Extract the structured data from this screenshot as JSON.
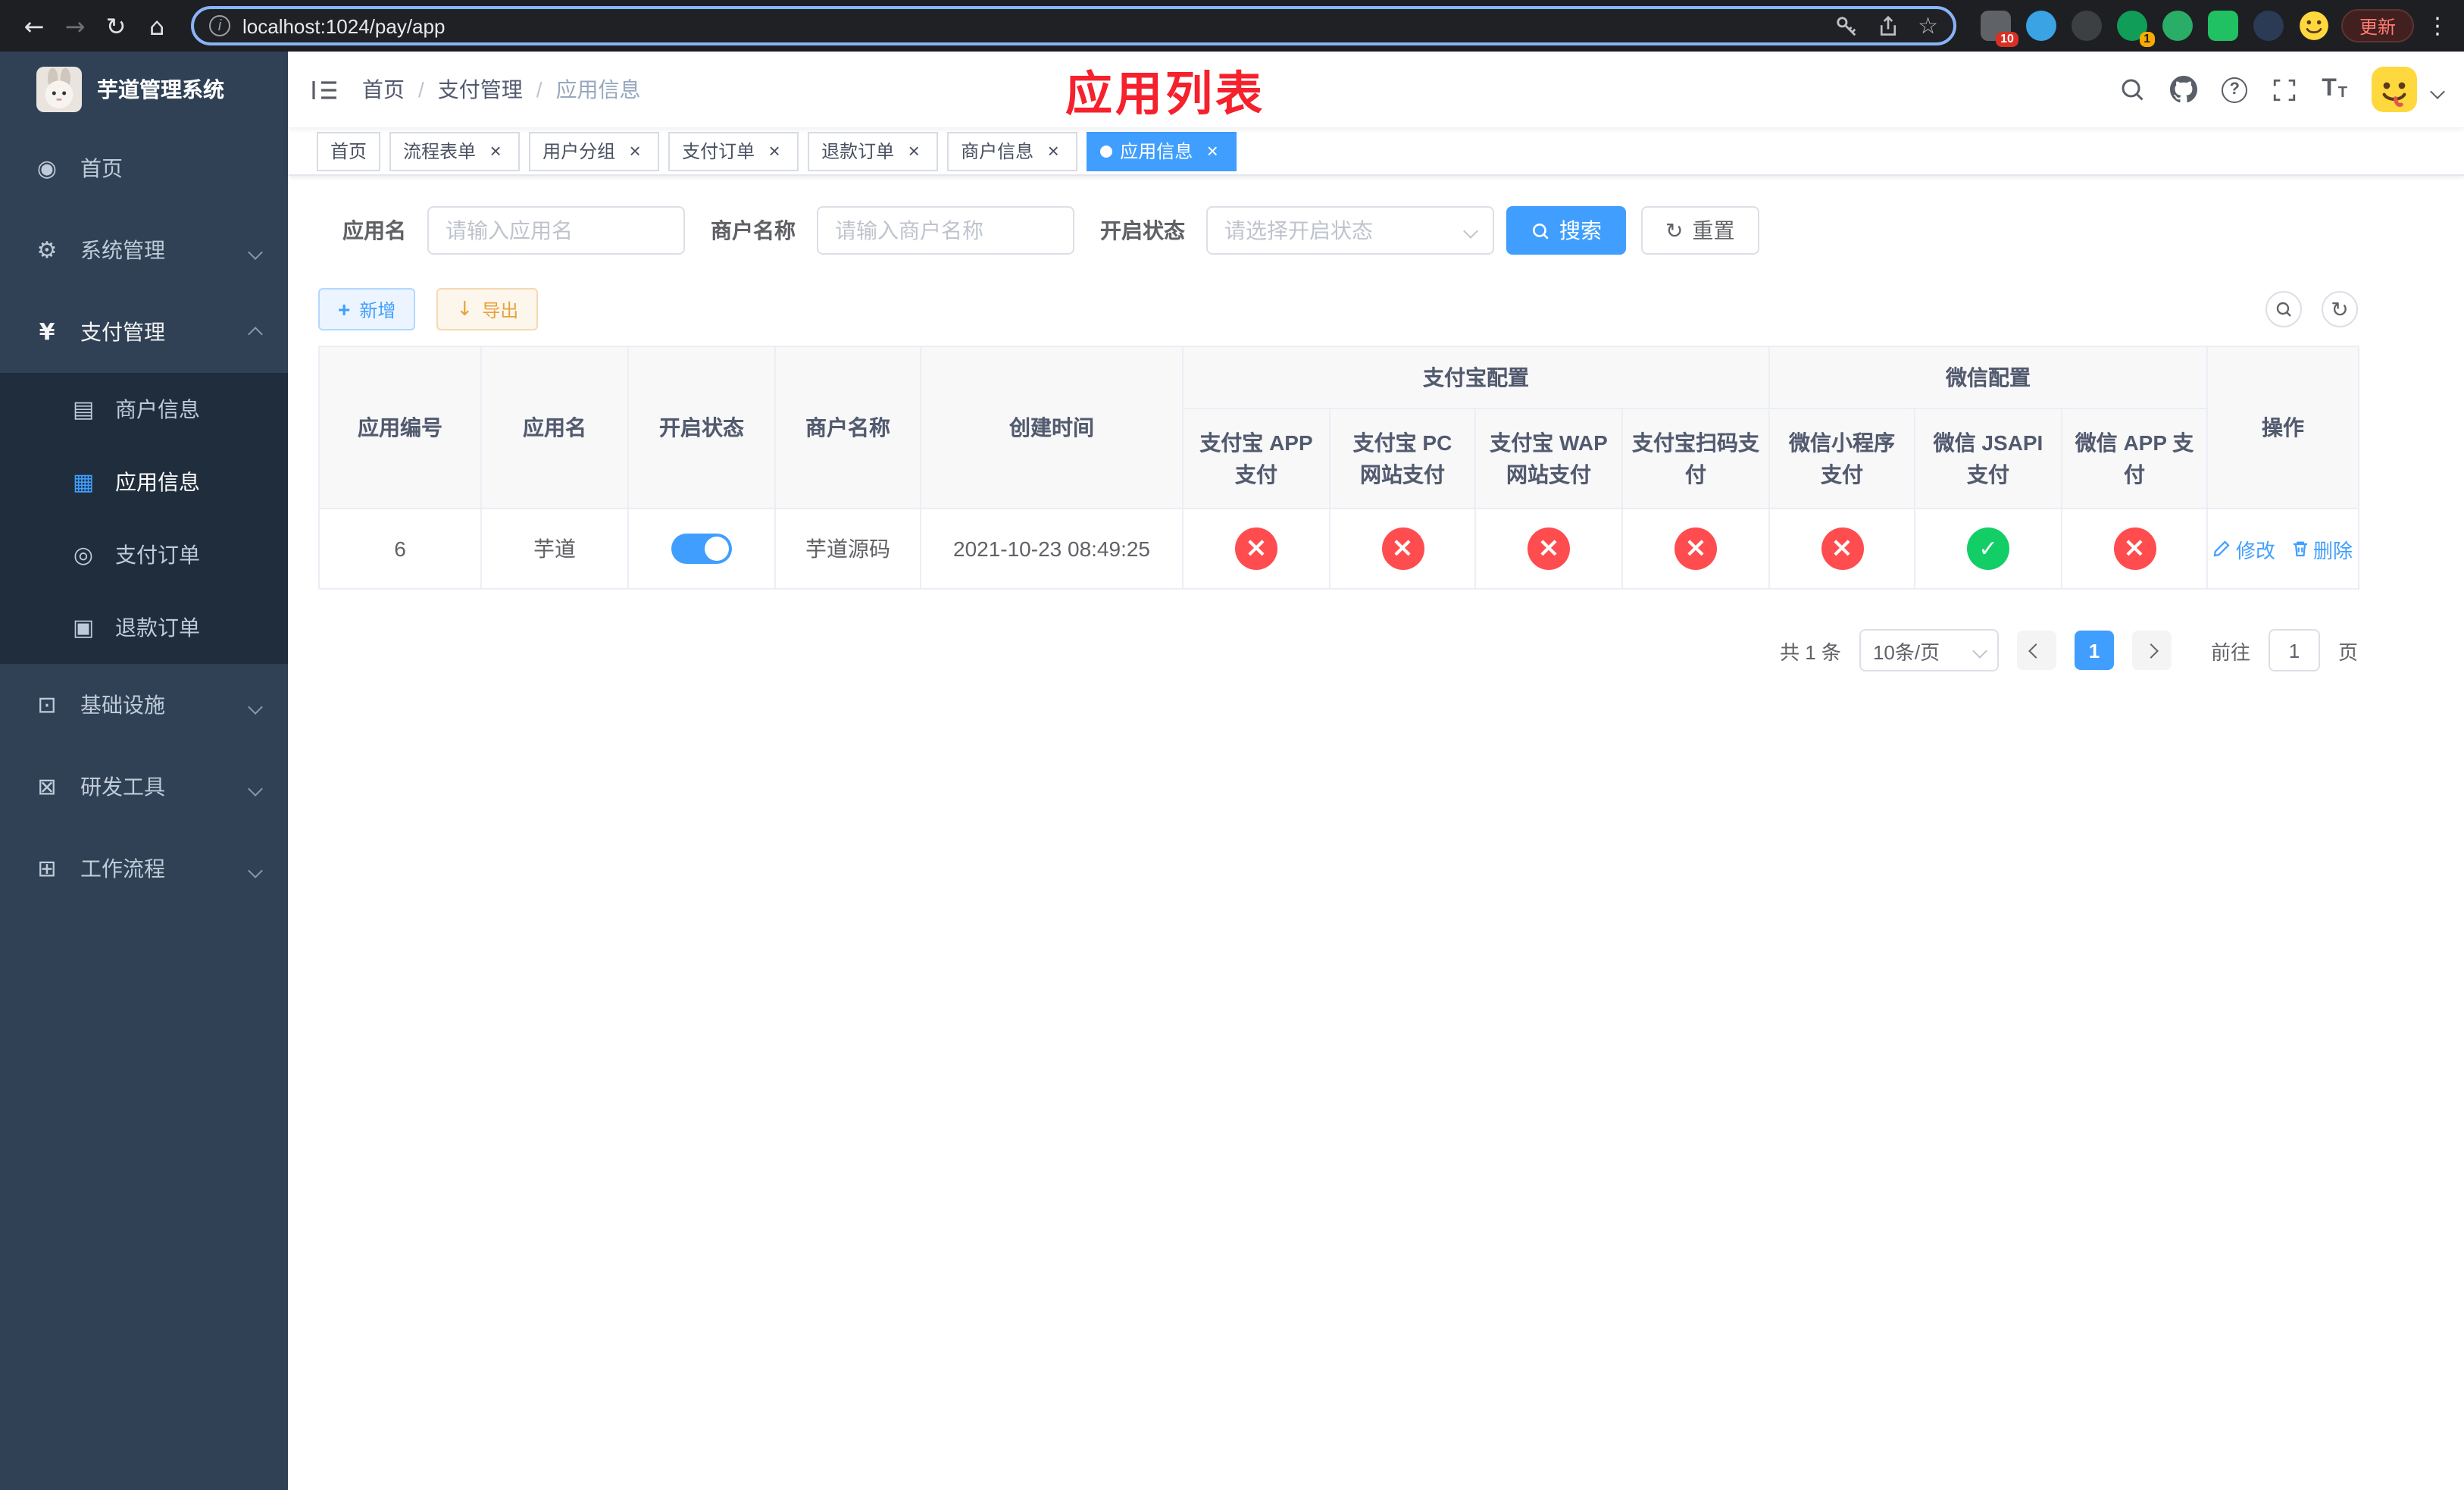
{
  "colors": {
    "primary": "#409eff",
    "success": "#13ce66",
    "danger": "#ff4d4f",
    "warning": "#e6a23c",
    "sidebar-bg": "#304156",
    "sidebar-sub-bg": "#1f2d3d",
    "sidebar-text": "#bfcbd9",
    "title-red": "#f5222d"
  },
  "browser": {
    "url": "localhost:1024/pay/app",
    "update_button": "更新",
    "extension_badge_count": "10",
    "profile_badge_count": "1"
  },
  "sidebar": {
    "title": "芋道管理系统",
    "items": [
      {
        "label": "首页"
      },
      {
        "label": "系统管理"
      },
      {
        "label": "支付管理"
      },
      {
        "label": "基础设施"
      },
      {
        "label": "研发工具"
      },
      {
        "label": "工作流程"
      }
    ],
    "pay_children": [
      {
        "label": "商户信息"
      },
      {
        "label": "应用信息"
      },
      {
        "label": "支付订单"
      },
      {
        "label": "退款订单"
      }
    ]
  },
  "breadcrumb": {
    "separator": "/",
    "items": [
      "首页",
      "支付管理",
      "应用信息"
    ]
  },
  "page_title": "应用列表",
  "tabs": [
    {
      "label": "首页"
    },
    {
      "label": "流程表单"
    },
    {
      "label": "用户分组"
    },
    {
      "label": "支付订单"
    },
    {
      "label": "退款订单"
    },
    {
      "label": "商户信息"
    },
    {
      "label": "应用信息"
    }
  ],
  "filters": {
    "app_name_label": "应用名",
    "app_name_placeholder": "请输入应用名",
    "merchant_label": "商户名称",
    "merchant_placeholder": "请输入商户名称",
    "status_label": "开启状态",
    "status_placeholder": "请选择开启状态",
    "search_button": "搜索",
    "reset_button": "重置"
  },
  "toolbar": {
    "add_button": "新增",
    "export_button": "导出"
  },
  "table": {
    "headers": {
      "app_id": "应用编号",
      "app_name": "应用名",
      "status": "开启状态",
      "merchant": "商户名称",
      "created": "创建时间",
      "alipay_group": "支付宝配置",
      "wechat_group": "微信配置",
      "alipay_app": "支付宝 APP 支付",
      "alipay_pc": "支付宝 PC 网站支付",
      "alipay_wap": "支付宝 WAP 网站支付",
      "alipay_qr": "支付宝扫码支付",
      "wechat_mini": "微信小程序支付",
      "wechat_jsapi": "微信 JSAPI 支付",
      "wechat_app": "微信 APP 支付",
      "actions": "操作"
    },
    "row": {
      "app_id": "6",
      "app_name": "芋道",
      "status_enabled": true,
      "merchant": "芋道源码",
      "created": "2021-10-23 08:49:25",
      "alipay_app": "disabled",
      "alipay_pc": "disabled",
      "alipay_wap": "disabled",
      "alipay_qr": "disabled",
      "wechat_mini": "disabled",
      "wechat_jsapi": "enabled",
      "wechat_app": "disabled",
      "edit_link": "修改",
      "delete_link": "删除"
    }
  },
  "pagination": {
    "total_text": "共 1 条",
    "page_size_text": "10条/页",
    "current_page": "1",
    "goto_label": "前往",
    "goto_value": "1",
    "goto_unit": "页"
  }
}
